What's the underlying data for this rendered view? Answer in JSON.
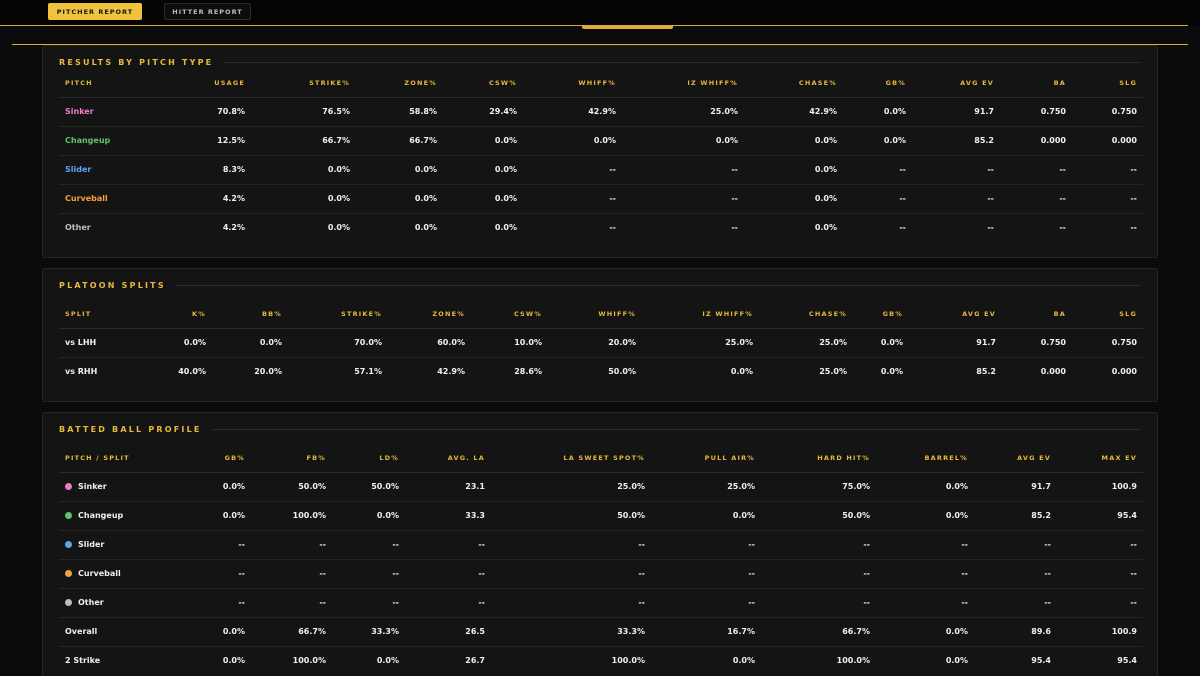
{
  "tabs": [
    {
      "label": "PITCHER REPORT",
      "active": true
    },
    {
      "label": "HITTER REPORT",
      "active": false
    }
  ],
  "colors": {
    "accent": "#e7b93c",
    "sinker": "#ea7fc8",
    "changeup": "#5fc46a",
    "slider": "#5aa8ee",
    "curveball": "#f4a23f",
    "other": "#bdbdbd"
  },
  "pitch_results": {
    "title": "RESULTS BY PITCH TYPE",
    "columns": [
      "PITCH",
      "USAGE",
      "STRIKE%",
      "ZONE%",
      "CSW%",
      "WHIFF%",
      "IZ WHIFF%",
      "CHASE%",
      "GB%",
      "AVG EV",
      "BA",
      "SLG"
    ],
    "rows": [
      {
        "label": "Sinker",
        "color_key": "sinker",
        "values": [
          "70.8%",
          "76.5%",
          "58.8%",
          "29.4%",
          "42.9%",
          "25.0%",
          "42.9%",
          "0.0%",
          "91.7",
          "0.750",
          "0.750"
        ]
      },
      {
        "label": "Changeup",
        "color_key": "changeup",
        "values": [
          "12.5%",
          "66.7%",
          "66.7%",
          "0.0%",
          "0.0%",
          "0.0%",
          "0.0%",
          "0.0%",
          "85.2",
          "0.000",
          "0.000"
        ]
      },
      {
        "label": "Slider",
        "color_key": "slider",
        "values": [
          "8.3%",
          "0.0%",
          "0.0%",
          "0.0%",
          "--",
          "--",
          "0.0%",
          "--",
          "--",
          "--",
          "--"
        ]
      },
      {
        "label": "Curveball",
        "color_key": "curveball",
        "values": [
          "4.2%",
          "0.0%",
          "0.0%",
          "0.0%",
          "--",
          "--",
          "0.0%",
          "--",
          "--",
          "--",
          "--"
        ]
      },
      {
        "label": "Other",
        "color_key": "other",
        "values": [
          "4.2%",
          "0.0%",
          "0.0%",
          "0.0%",
          "--",
          "--",
          "0.0%",
          "--",
          "--",
          "--",
          "--"
        ]
      }
    ]
  },
  "platoon": {
    "title": "PLATOON SPLITS",
    "columns": [
      "SPLIT",
      "K%",
      "BB%",
      "STRIKE%",
      "ZONE%",
      "CSW%",
      "WHIFF%",
      "IZ WHIFF%",
      "CHASE%",
      "GB%",
      "AVG EV",
      "BA",
      "SLG"
    ],
    "rows": [
      {
        "label": "vs LHH",
        "values": [
          "0.0%",
          "0.0%",
          "70.0%",
          "60.0%",
          "10.0%",
          "20.0%",
          "25.0%",
          "25.0%",
          "0.0%",
          "91.7",
          "0.750",
          "0.750"
        ]
      },
      {
        "label": "vs RHH",
        "values": [
          "40.0%",
          "20.0%",
          "57.1%",
          "42.9%",
          "28.6%",
          "50.0%",
          "0.0%",
          "25.0%",
          "0.0%",
          "85.2",
          "0.000",
          "0.000"
        ]
      }
    ]
  },
  "batted_ball": {
    "title": "BATTED BALL PROFILE",
    "columns": [
      "PITCH / SPLIT",
      "GB%",
      "FB%",
      "LD%",
      "AVG. LA",
      "LA SWEET SPOT%",
      "PULL AIR%",
      "HARD HIT%",
      "BARREL%",
      "AVG EV",
      "MAX EV"
    ],
    "rows": [
      {
        "label": "Sinker",
        "color_key": "sinker",
        "values": [
          "0.0%",
          "50.0%",
          "50.0%",
          "23.1",
          "25.0%",
          "25.0%",
          "75.0%",
          "0.0%",
          "91.7",
          "100.9"
        ]
      },
      {
        "label": "Changeup",
        "color_key": "changeup",
        "values": [
          "0.0%",
          "100.0%",
          "0.0%",
          "33.3",
          "50.0%",
          "0.0%",
          "50.0%",
          "0.0%",
          "85.2",
          "95.4"
        ]
      },
      {
        "label": "Slider",
        "color_key": "slider",
        "values": [
          "--",
          "--",
          "--",
          "--",
          "--",
          "--",
          "--",
          "--",
          "--",
          "--"
        ]
      },
      {
        "label": "Curveball",
        "color_key": "curveball",
        "values": [
          "--",
          "--",
          "--",
          "--",
          "--",
          "--",
          "--",
          "--",
          "--",
          "--"
        ]
      },
      {
        "label": "Other",
        "color_key": "other",
        "values": [
          "--",
          "--",
          "--",
          "--",
          "--",
          "--",
          "--",
          "--",
          "--",
          "--"
        ]
      },
      {
        "label": "Overall",
        "values": [
          "0.0%",
          "66.7%",
          "33.3%",
          "26.5",
          "33.3%",
          "16.7%",
          "66.7%",
          "0.0%",
          "89.6",
          "100.9"
        ]
      },
      {
        "label": "2 Strike",
        "values": [
          "0.0%",
          "100.0%",
          "0.0%",
          "26.7",
          "100.0%",
          "0.0%",
          "100.0%",
          "0.0%",
          "95.4",
          "95.4"
        ]
      }
    ]
  }
}
